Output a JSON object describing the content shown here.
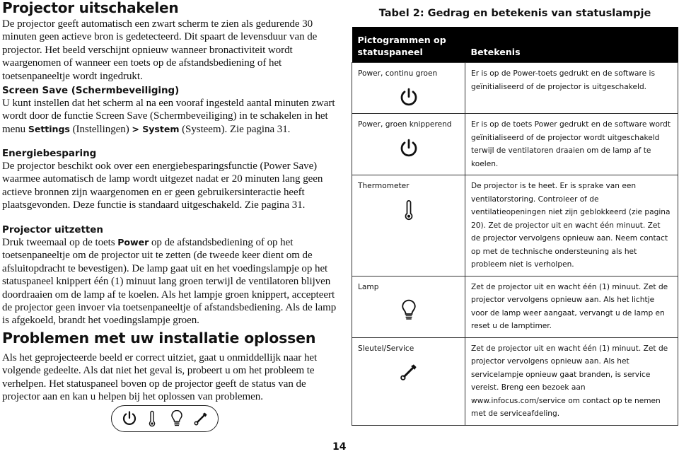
{
  "left_column": {
    "sections": [
      {
        "title": "Projector uitschakelen",
        "body": "De projector geeft automatisch een zwart scherm te zien als gedurende 30 minuten geen actieve bron is gedetecteerd. Dit spaart de levensduur van de projector. Het beeld verschijnt opnieuw wanneer bronactiviteit wordt waargenomen of wanneer een toets op de afstandsbediening of het toetsenpaneeltje wordt ingedrukt."
      },
      {
        "title": "Screen Save (Schermbeveiliging)",
        "body_parts": {
          "before": "U kunt instellen dat het scherm al na een vooraf ingesteld aantal minuten zwart wordt door de functie Screen Save (Schermbeveiliging) in te schakelen in het menu ",
          "bold1": "Settings",
          "middle": " (Instellingen) ",
          "bold2": "> System",
          "after": " (Systeem). Zie pagina 31."
        }
      },
      {
        "title": "Energiebesparing",
        "body": "De projector beschikt ook over een energiebesparingsfunctie (Power Save) waarmee automatisch de lamp wordt uitgezet nadat er 20 minuten lang geen actieve bronnen zijn waargenomen en er geen gebruikersinteractie heeft plaatsgevonden. Deze functie is standaard uitgeschakeld. Zie pagina 31."
      },
      {
        "title": "Projector uitzetten",
        "body_parts": {
          "before": "Druk tweemaal op de toets ",
          "bold": "Power",
          "after": " op de afstandsbediening of op het toetsenpaneeltje om de projector uit te zetten (de tweede keer dient om de afsluitopdracht te bevestigen). De lamp gaat uit en het voedingslampje op het statuspaneel knippert één (1) minuut lang groen terwijl de ventilatoren blijven doordraaien om de lamp af te koelen. Als het lampje groen knippert, accepteert de projector geen invoer via toetsenpaneeltje of afstandsbediening. Als de lamp is afgekoeld, brandt het voedingslampje groen."
        }
      },
      {
        "title": "Problemen met uw installatie oplossen",
        "body": "Als het geprojecteerde beeld er correct uitziet, gaat u onmiddellijk naar het volgende gedeelte. Als dat niet het geval is, probeert u om het probleem te verhelpen. Het statuspaneel boven op de projector geeft de status van de projector aan en kan u helpen bij het oplossen van problemen."
      }
    ],
    "status_panel_icons": [
      "power-icon",
      "thermometer-icon",
      "lamp-icon",
      "wrench-icon"
    ]
  },
  "table": {
    "caption": "Tabel 2: Gedrag en betekenis van statuslampje",
    "headers": [
      "Pictogrammen op statuspaneel",
      "Betekenis"
    ],
    "rows": [
      {
        "name": "Power, continu groen",
        "icon": "power-icon",
        "meaning": "Er is op de Power-toets gedrukt en de software is geïnitialiseerd of de projector is uitgeschakeld."
      },
      {
        "name": "Power, groen knipperend",
        "icon": "power-icon",
        "meaning": "Er is op de toets Power gedrukt en de software wordt geïnitialiseerd of de projector wordt uitgeschakeld terwijl de ventilatoren draaien om de lamp af te koelen."
      },
      {
        "name": "Thermometer",
        "icon": "thermometer-icon",
        "meaning": "De projector is te heet. Er is sprake van een ventilatorstoring. Controleer of de ventilatieopeningen niet zijn geblokkeerd (zie pagina 20). Zet de projector uit en wacht één minuut. Zet de projector vervolgens opnieuw aan. Neem contact op met de technische ondersteuning als het probleem niet is verholpen."
      },
      {
        "name": "Lamp",
        "icon": "lamp-icon",
        "meaning": "Zet de projector uit en wacht één (1) minuut. Zet de projector vervolgens opnieuw aan. Als het lichtje voor de lamp weer aangaat, vervangt u de lamp en reset u de lamptimer."
      },
      {
        "name": "Sleutel/Service",
        "icon": "wrench-icon",
        "meaning": "Zet de projector uit en wacht één (1) minuut. Zet de projector vervolgens opnieuw aan. Als het servicelampje opnieuw gaat branden, is service vereist. Breng een bezoek aan www.infocus.com/service om contact op te nemen met de serviceafdeling."
      }
    ]
  },
  "page_number": "14"
}
